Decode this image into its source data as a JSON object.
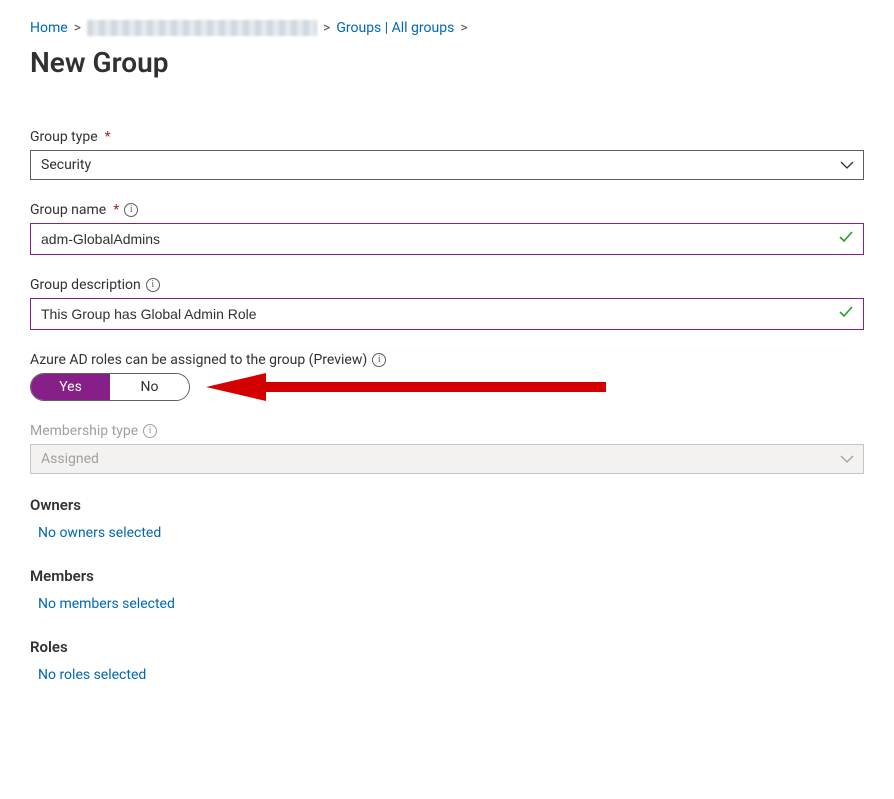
{
  "breadcrumb": {
    "home": "Home",
    "groups": "Groups | All groups"
  },
  "page_title": "New Group",
  "fields": {
    "group_type": {
      "label": "Group type",
      "value": "Security"
    },
    "group_name": {
      "label": "Group name",
      "value": "adm-GlobalAdmins"
    },
    "group_description": {
      "label": "Group description",
      "value": "This Group has Global Admin Role"
    },
    "roles_assignable": {
      "label": "Azure AD roles can be assigned to the group (Preview)",
      "yes": "Yes",
      "no": "No"
    },
    "membership_type": {
      "label": "Membership type",
      "value": "Assigned"
    }
  },
  "sections": {
    "owners": {
      "title": "Owners",
      "link": "No owners selected"
    },
    "members": {
      "title": "Members",
      "link": "No members selected"
    },
    "roles": {
      "title": "Roles",
      "link": "No roles selected"
    }
  }
}
